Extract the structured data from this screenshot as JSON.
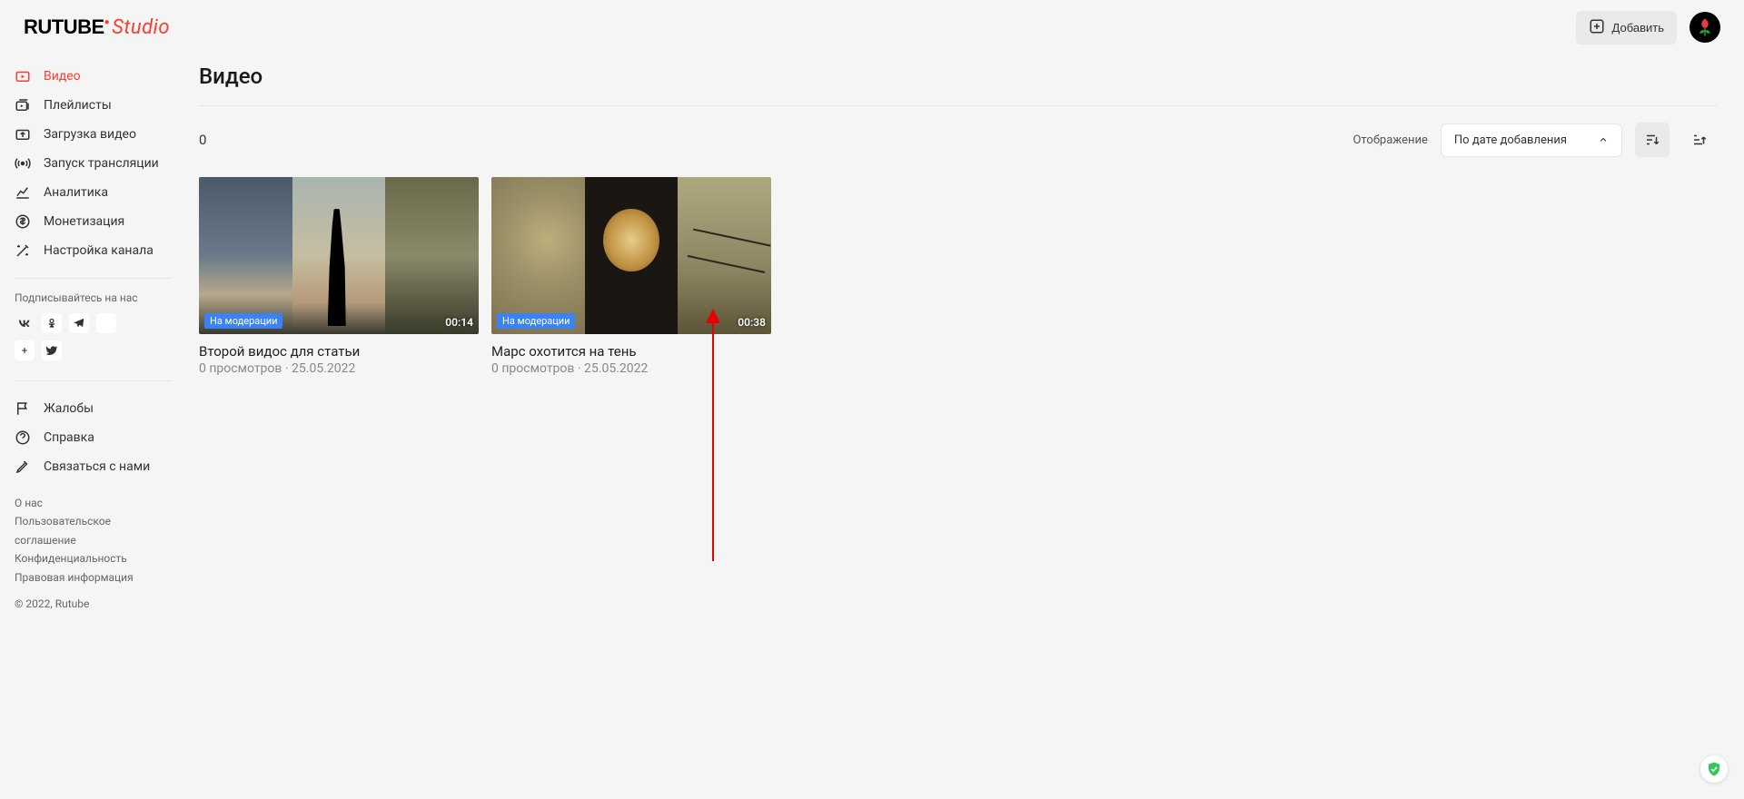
{
  "header": {
    "logo_rutube": "RUTUBE",
    "logo_studio": "Studio",
    "add_label": "Добавить"
  },
  "sidebar": {
    "items": [
      {
        "label": "Видео"
      },
      {
        "label": "Плейлисты"
      },
      {
        "label": "Загрузка видео"
      },
      {
        "label": "Запуск трансляции"
      },
      {
        "label": "Аналитика"
      },
      {
        "label": "Монетизация"
      },
      {
        "label": "Настройка канала"
      }
    ],
    "follow_label": "Подписывайтесь на нас",
    "help_items": [
      {
        "label": "Жалобы"
      },
      {
        "label": "Справка"
      },
      {
        "label": "Связаться с нами"
      }
    ],
    "footer_links": [
      "О нас",
      "Пользовательское соглашение",
      "Конфиденциальность",
      "Правовая информация"
    ],
    "copyright": "© 2022, Rutube"
  },
  "page": {
    "title": "Видео",
    "count": "0",
    "display_label": "Отображение",
    "sort_label": "По дате добавления"
  },
  "videos": [
    {
      "title": "Второй видос для статьи",
      "views": "0 просмотров",
      "dot": "·",
      "date": "25.05.2022",
      "badge": "На модерации",
      "duration": "00:14"
    },
    {
      "title": "Марс охотится на тень",
      "views": "0 просмотров",
      "dot": "·",
      "date": "25.05.2022",
      "badge": "На модерации",
      "duration": "00:38"
    }
  ]
}
